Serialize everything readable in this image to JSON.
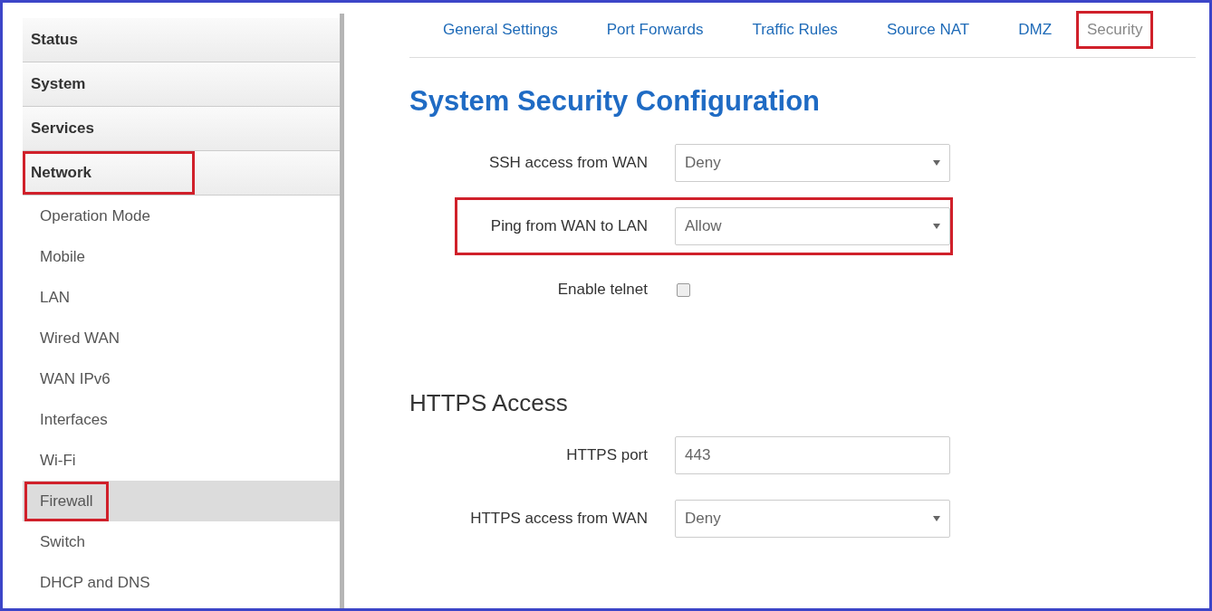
{
  "sidebar": {
    "items": [
      {
        "label": "Status",
        "highlighted": false
      },
      {
        "label": "System",
        "highlighted": false
      },
      {
        "label": "Services",
        "highlighted": false
      },
      {
        "label": "Network",
        "highlighted": true,
        "children": [
          {
            "label": "Operation Mode",
            "selected": false,
            "highlighted": false
          },
          {
            "label": "Mobile",
            "selected": false,
            "highlighted": false
          },
          {
            "label": "LAN",
            "selected": false,
            "highlighted": false
          },
          {
            "label": "Wired WAN",
            "selected": false,
            "highlighted": false
          },
          {
            "label": "WAN IPv6",
            "selected": false,
            "highlighted": false
          },
          {
            "label": "Interfaces",
            "selected": false,
            "highlighted": false
          },
          {
            "label": "Wi-Fi",
            "selected": false,
            "highlighted": false
          },
          {
            "label": "Firewall",
            "selected": true,
            "highlighted": true
          },
          {
            "label": "Switch",
            "selected": false,
            "highlighted": false
          },
          {
            "label": "DHCP and DNS",
            "selected": false,
            "highlighted": false
          }
        ]
      }
    ]
  },
  "tabs": [
    {
      "label": "General Settings",
      "selected": false,
      "highlighted": false
    },
    {
      "label": "Port Forwards",
      "selected": false,
      "highlighted": false
    },
    {
      "label": "Traffic Rules",
      "selected": false,
      "highlighted": false
    },
    {
      "label": "Source NAT",
      "selected": false,
      "highlighted": false
    },
    {
      "label": "DMZ",
      "selected": false,
      "highlighted": false
    },
    {
      "label": "Security",
      "selected": true,
      "highlighted": true
    }
  ],
  "sections": [
    {
      "kind": "page-title",
      "title": "System Security Configuration",
      "fields": [
        {
          "kind": "select",
          "label": "SSH access from WAN",
          "value": "Deny",
          "highlighted": false
        },
        {
          "kind": "select",
          "label": "Ping from WAN to LAN",
          "value": "Allow",
          "highlighted": true
        },
        {
          "kind": "checkbox",
          "label": "Enable telnet",
          "checked": false,
          "highlighted": false
        }
      ]
    },
    {
      "kind": "section-title",
      "title": "HTTPS Access",
      "fields": [
        {
          "kind": "text",
          "label": "HTTPS port",
          "value": "443",
          "highlighted": false
        },
        {
          "kind": "select",
          "label": "HTTPS access from WAN",
          "value": "Deny",
          "highlighted": false
        }
      ]
    }
  ]
}
